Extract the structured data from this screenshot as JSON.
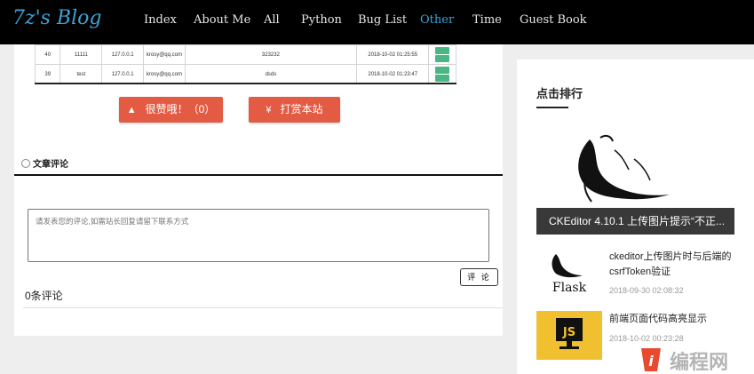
{
  "header": {
    "logo": "7z's Blog",
    "nav": [
      {
        "label": "Index",
        "active": false
      },
      {
        "label": "About Me",
        "active": false
      },
      {
        "label": "All",
        "active": false
      },
      {
        "label": "Python",
        "active": false
      },
      {
        "label": "Bug List",
        "active": false
      },
      {
        "label": "Other",
        "active": true
      },
      {
        "label": "Time",
        "active": false
      },
      {
        "label": "Guest Book",
        "active": false
      }
    ]
  },
  "screenshot_table": {
    "rows": [
      {
        "id": "40",
        "name": "11111",
        "ip": "127.0.0.1",
        "email": "krosy@qq.com",
        "content": "323232",
        "time": "2018-10-02 01:25:55"
      },
      {
        "id": "39",
        "name": "test",
        "ip": "127.0.0.1",
        "email": "krosy@qq.com",
        "content": "dsds",
        "time": "2018-10-02 01:23:47"
      }
    ]
  },
  "actions": {
    "like_label": "很赞哦！（0）",
    "donate_label": "打赏本站"
  },
  "comments": {
    "heading": "文章评论",
    "placeholder": "请发表您的评论,如需站长回复请留下联系方式",
    "submit_label": "评 论",
    "count_label": "0条评论"
  },
  "sidebar": {
    "title": "点击排行",
    "featured": {
      "title": "CKEditor 4.10.1 上传图片提示“不正..."
    },
    "items": [
      {
        "title": "ckeditor上传图片时与后端的csrfToken验证",
        "date": "2018-09-30 02:08:32",
        "thumb_text": "Flask"
      },
      {
        "title": "前端页面代码高亮显示",
        "date": "2018-10-02 00:23:28",
        "thumb_text": "JS"
      }
    ]
  },
  "watermark": {
    "text": "编程网",
    "logo_text": "i"
  },
  "colors": {
    "accent": "#3aa3d8",
    "button_red": "#e35b43",
    "js_yellow": "#f0c030",
    "watermark_red": "#e8492f"
  }
}
